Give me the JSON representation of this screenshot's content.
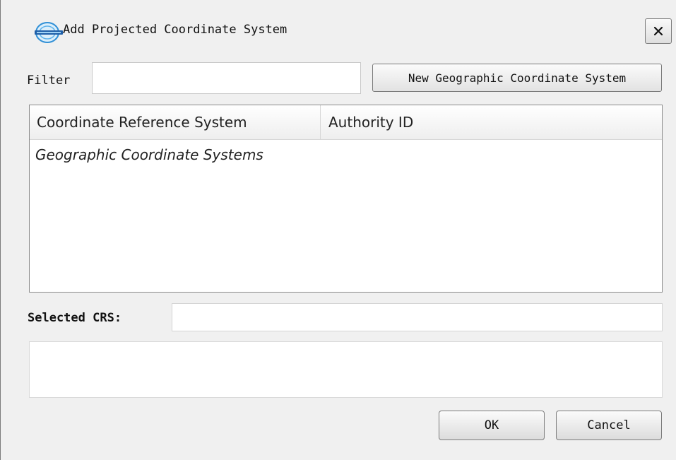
{
  "window": {
    "title": "Add Projected Coordinate System",
    "logo_icon": "app-logo-icon",
    "close_icon": "close-icon"
  },
  "filter": {
    "label": "Filter",
    "value": "",
    "placeholder": ""
  },
  "toolbar": {
    "new_geographic_label": "New Geographic Coordinate System"
  },
  "table": {
    "columns": [
      "Coordinate Reference System",
      "Authority ID"
    ],
    "rows": [
      {
        "name": "Geographic Coordinate Systems",
        "authority_id": ""
      }
    ]
  },
  "selected_crs": {
    "label": "Selected CRS:",
    "value": ""
  },
  "description": "",
  "buttons": {
    "ok": "OK",
    "cancel": "Cancel"
  }
}
